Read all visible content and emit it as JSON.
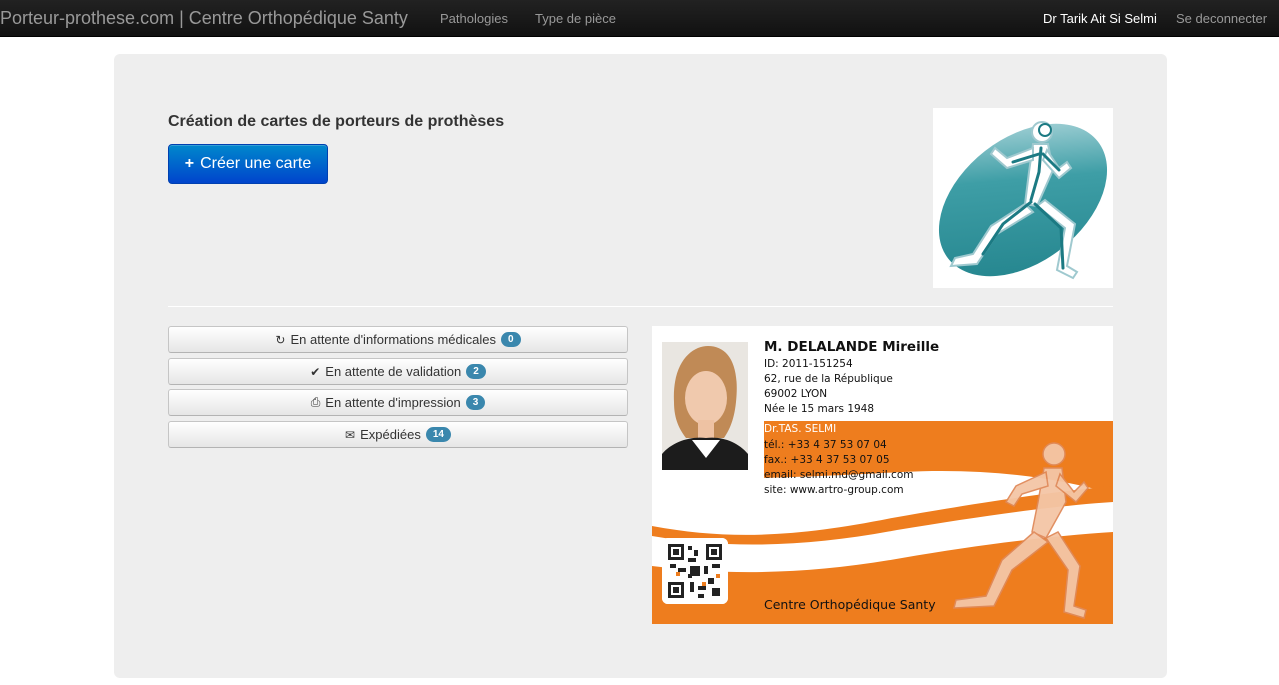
{
  "navbar": {
    "brand": "Porteur-prothese.com | Centre Orthopédique Santy",
    "links": [
      "Pathologies",
      "Type de pièce"
    ],
    "user": "Dr Tarik Ait Si Selmi",
    "logout": "Se deconnecter"
  },
  "hero": {
    "title": "Création de cartes de porteurs de prothèses",
    "create_button": "Créer une carte"
  },
  "status_buttons": [
    {
      "icon": "refresh-icon",
      "label": "En attente d'informations médicales",
      "count": "0"
    },
    {
      "icon": "check-icon",
      "label": "En attente de validation",
      "count": "2"
    },
    {
      "icon": "print-icon",
      "label": "En attente d'impression",
      "count": "3"
    },
    {
      "icon": "envelope-icon",
      "label": "Expédiées",
      "count": "14"
    }
  ],
  "card": {
    "name": "M. DELALANDE Mireille",
    "id": "ID: 2011-151254",
    "address1": "62, rue de la République",
    "address2": "69002 LYON",
    "birth": "Née le 15 mars 1948",
    "doctor": "Dr.TAS. SELMI",
    "tel": "tél.: +33 4 37 53 07 04",
    "fax": "fax.: +33 4 37 53 07 05",
    "email": "email: selmi.md@gmail.com",
    "site": "site: www.artro-group.com",
    "footer": "Centre Orthopédique Santy"
  },
  "colors": {
    "accent": "#0066cc",
    "badge": "#3a87ad",
    "card_orange": "#ee7d1e",
    "logo_teal": "#2a8f98"
  }
}
